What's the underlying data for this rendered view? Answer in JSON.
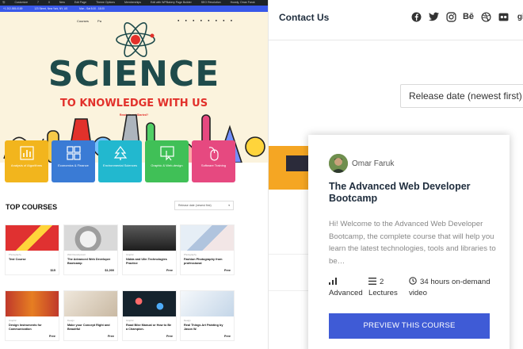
{
  "small": {
    "wpbar": [
      "Customize",
      "7",
      "0",
      "New",
      "Edit Page",
      "Theme Options",
      "Memberships",
      "Edit with WPBakery Page Builder",
      "SEO Revolution",
      "Howdy, Omar Faruk"
    ],
    "topbar": [
      "+1 202-555-0189",
      "123 Street, New York, NY, US",
      "Mon - Sat 8.00 - 18.00"
    ],
    "nav": [
      "Courses",
      "Pa"
    ],
    "hero_title": "SCIENCE",
    "hero_subtitle": "TO KNOWLEDGE WITH US",
    "hero_ready": "Ready to get Started?",
    "categories": [
      {
        "label": "Analysis of Algorithms",
        "color": "#f2b51d",
        "icon": "chart-icon"
      },
      {
        "label": "Economics & Finance",
        "color": "#3a7bd5",
        "icon": "grid-icon"
      },
      {
        "label": "Environmental Sciences",
        "color": "#22b8cf",
        "icon": "tree-icon"
      },
      {
        "label": "Graphic & Web-design",
        "color": "#40c057",
        "icon": "cursor-icon"
      },
      {
        "label": "Software Training",
        "color": "#e64980",
        "icon": "mouse-icon"
      }
    ],
    "top_courses": "TOP COURSES",
    "sort_label": "Release date (newest first)",
    "courses": [
      {
        "cat": "Photography",
        "title": "Test Course",
        "price": "$15",
        "thumb": "#e03131"
      },
      {
        "cat": "Web Development",
        "title": "The Advanced Web Developer Bootcamp",
        "price": "$1,000",
        "thumb": "#cfcfcf"
      },
      {
        "cat": "Graphic",
        "title": "Nidda and Ulin Technologies Practice",
        "price": "Free",
        "thumb": "#3a3a3a"
      },
      {
        "cat": "Photography",
        "title": "Fashion Photography from professional",
        "price": "Free",
        "thumb": "#c5d6e8"
      },
      {
        "cat": "Graphic",
        "title": "Design Instruments for Communication",
        "price": "Free",
        "thumb": "#c0392b"
      },
      {
        "cat": "Design",
        "title": "Make your Concept Right and Beautiful",
        "price": "Free",
        "thumb": "#d8cfc2"
      },
      {
        "cat": "Graphic",
        "title": "Road Bike Manual or How to Be a Champion.",
        "price": "Free",
        "thumb": "#1b2a35"
      },
      {
        "cat": "Design",
        "title": "Real Things Art Painting by Jason W.",
        "price": "Free",
        "thumb": "#dbe6f0"
      }
    ]
  },
  "header": {
    "contact": "Contact Us",
    "social": [
      "facebook-icon",
      "twitter-icon",
      "instagram-icon",
      "behance-icon",
      "dribbble-icon",
      "flickr-icon",
      "github-icon"
    ],
    "behance_text": "Bē",
    "flickr_text": "••",
    "github_text": "git"
  },
  "sort": {
    "label": "Release date (newest first)"
  },
  "popup": {
    "author": "Omar Faruk",
    "title": "The Advanced Web Developer Bootcamp",
    "description": "Hi! Welcome to the Advanced Web Developer Bootcamp, the complete course that will help you learn the latest technologies, tools and libraries to be…",
    "level": "Advanced",
    "lectures_count": "2",
    "lectures_label": "Lectures",
    "duration_top": "34 hours on-demand",
    "duration_bottom": "video",
    "button": "PREVIEW THIS COURSE"
  },
  "colors": {
    "accent": "#3f5bd6"
  }
}
